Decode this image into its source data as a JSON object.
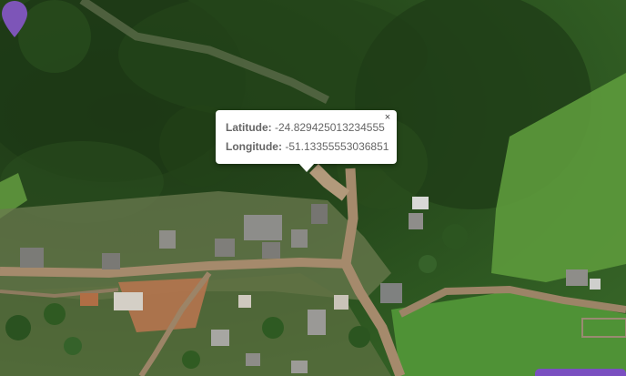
{
  "map": {
    "view": "satellite",
    "marker": {
      "icon": "map-pin-icon",
      "color": "#7d55b8"
    }
  },
  "popup": {
    "latitude_label": "Latitude:",
    "latitude_value": "-24.829425013234555",
    "longitude_label": "Longitude:",
    "longitude_value": "-51.13355553036851",
    "close_label": "×"
  },
  "colors": {
    "accent": "#7a4fc0",
    "forest_dark": "#1f3a17",
    "pasture": "#5d9a3c",
    "dirt_road": "#a58a6c",
    "bare_soil": "#b5744f"
  }
}
